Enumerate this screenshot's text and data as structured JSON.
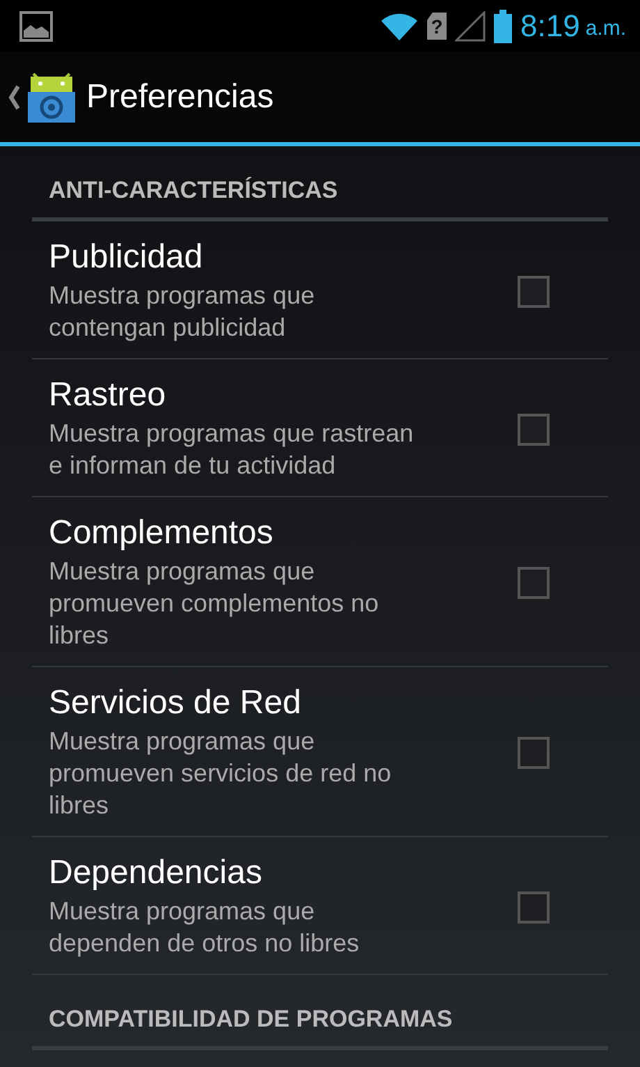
{
  "status_bar": {
    "sim_mark": "?",
    "time": "8:19",
    "period": "a.m."
  },
  "action_bar": {
    "title": "Preferencias"
  },
  "sections": [
    {
      "header": "ANTI-CARACTERÍSTICAS",
      "items": [
        {
          "title": "Publicidad",
          "summary": "Muestra programas que contengan publicidad",
          "checked": false
        },
        {
          "title": "Rastreo",
          "summary": "Muestra programas que rastrean e informan de tu actividad",
          "checked": false
        },
        {
          "title": "Complementos",
          "summary": "Muestra programas que promueven complementos no libres",
          "checked": false
        },
        {
          "title": "Servicios de Red",
          "summary": "Muestra programas que promueven servicios de red no libres",
          "checked": false
        },
        {
          "title": "Dependencias",
          "summary": "Muestra programas que dependen de otros no libres",
          "checked": false
        }
      ]
    },
    {
      "header": "COMPATIBILIDAD DE PROGRAMAS"
    }
  ]
}
